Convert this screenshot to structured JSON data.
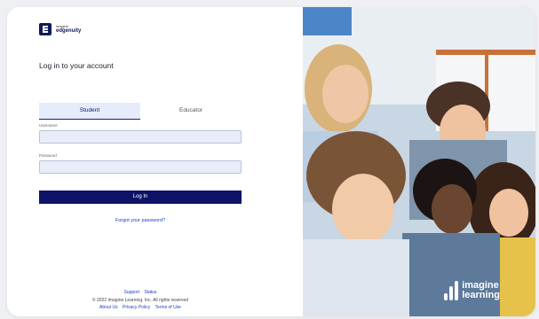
{
  "logo": {
    "line1": "imagine",
    "line2": "edgenuity",
    "icon": "edgenuity-logo-icon"
  },
  "title": "Log in to your account",
  "tabs": [
    {
      "label": "Student",
      "selected": true
    },
    {
      "label": "Educator",
      "selected": false
    }
  ],
  "username": {
    "label": "Username",
    "value": ""
  },
  "password": {
    "label": "Password",
    "value": "",
    "toggle_icon": "eye-slash-icon"
  },
  "login_button": "Log In",
  "forgot_link": "Forgot your password?",
  "footer": {
    "support": "Support",
    "status": "Status",
    "copyright": "© 2022 Imagine Learning, Inc. All rights reserved",
    "about": "About Us",
    "privacy": "Privacy Policy",
    "terms": "Terms of Use"
  },
  "brand": {
    "line1": "imagine",
    "line2": "learning"
  },
  "colors": {
    "primary": "#0e1368",
    "link": "#1a3cc9",
    "field_bg": "#e8edf9",
    "tab_active_bg": "#e6ecfb"
  }
}
